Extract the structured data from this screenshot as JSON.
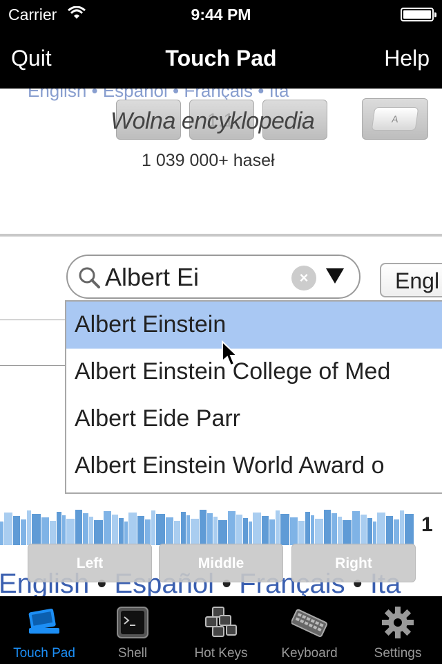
{
  "status_bar": {
    "carrier": "Carrier",
    "time": "9:44 PM"
  },
  "nav": {
    "title": "Touch Pad",
    "left_button": "Quit",
    "right_button": "Help"
  },
  "remote": {
    "top_languages": "English • Español • Français • Ita",
    "wiki_title": "Wolna encyklopedia",
    "ghost_text": "1:1",
    "keyboard_key_label": "A",
    "wiki_count": "1 039 000+ haseł",
    "search_value": "Albert Ei",
    "language_select": "Engl",
    "suggestions": [
      "Albert Einstein",
      "Albert Einstein College of Med",
      "Albert Eide Parr",
      "Albert Einstein World Award o"
    ],
    "books_number": "1",
    "bottom_languages": [
      "English",
      "Español",
      "Français",
      "Ita"
    ],
    "separator": " • "
  },
  "mouse_buttons": {
    "left": "Left",
    "middle": "Middle",
    "right": "Right"
  },
  "tabs": [
    {
      "label": "Touch Pad",
      "icon": "touchpad-icon",
      "active": true
    },
    {
      "label": "Shell",
      "icon": "terminal-icon",
      "active": false
    },
    {
      "label": "Hot Keys",
      "icon": "hotkeys-icon",
      "active": false
    },
    {
      "label": "Keyboard",
      "icon": "keyboard-icon",
      "active": false
    },
    {
      "label": "Settings",
      "icon": "gear-icon",
      "active": false
    }
  ],
  "colors": {
    "accent": "#1c8ef5",
    "selection": "#a9c8f3",
    "link": "#3a5fb0"
  }
}
